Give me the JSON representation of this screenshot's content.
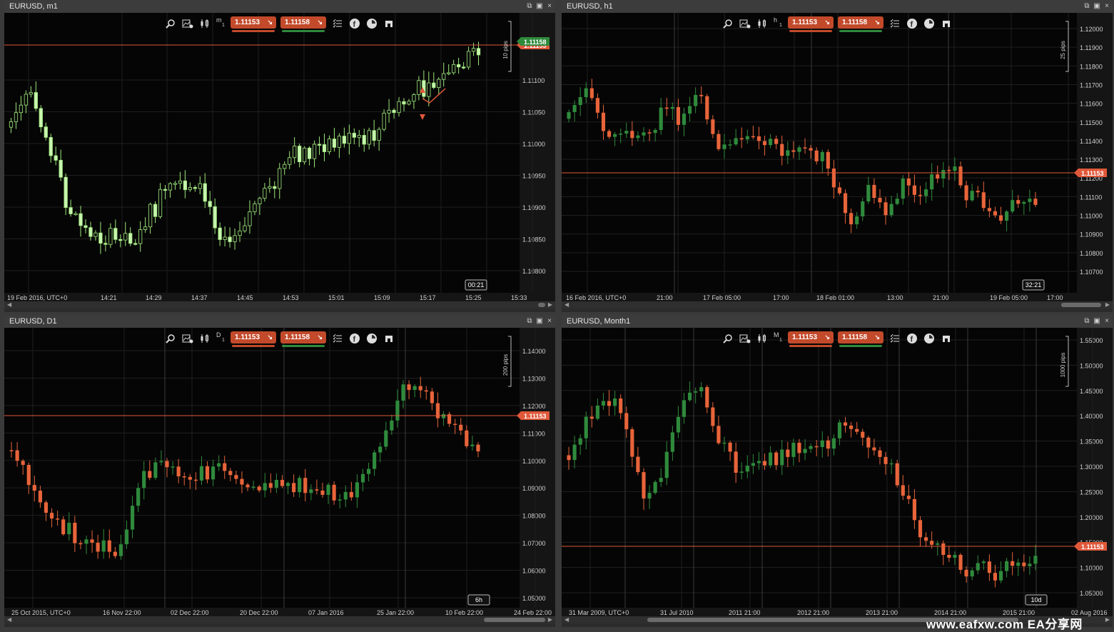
{
  "colors": {
    "bull": "#2f8a3c",
    "bear": "#e8643a",
    "m1_bull": "#0b0b0b",
    "m1_bear": "#c8f5b0",
    "m1_wick": "#9ee87a",
    "price_line": "#e0583a",
    "price_label_bg": "#e0583a",
    "sell_bar": "#c24a2b",
    "buy_bar": "#2f8a3c",
    "chart_bg": "#050505",
    "grid": "#1f1f1f",
    "axis_text": "#d0d0d0"
  },
  "window_controls": {
    "detach": "⧉",
    "maximize": "▣",
    "close": "×"
  },
  "toolbar": {
    "sell_price": "1.11153",
    "buy_price": "1.11158",
    "sell_arrow": "↘",
    "buy_arrow": "↘",
    "icons": [
      "zoom-icon",
      "chart-settings-icon",
      "chart-type-icon",
      "timeframe-selector",
      "sell-button",
      "buy-button",
      "order-list-icon",
      "facebook-icon",
      "sentiment-icon",
      "signal-icon"
    ]
  },
  "panels": [
    {
      "id": "m1",
      "title": "EURUSD, m1",
      "timeframe": "m",
      "timeframe_num": "1",
      "current_price": "1.11153",
      "countdown": "00:21",
      "range_label": "10 pips",
      "date_labels": [
        "19 Feb 2016, UTC+0",
        "14:21",
        "14:29",
        "14:37",
        "14:45",
        "14:53",
        "15:01",
        "15:09",
        "15:17",
        "15:25",
        "15:33"
      ],
      "price_ticks": [
        "1.11100",
        "1.11050",
        "1.11000",
        "1.10950",
        "1.10900",
        "1.10850",
        "1.10800"
      ],
      "extra_price_label": "1.11158"
    },
    {
      "id": "h1",
      "title": "EURUSD, h1",
      "timeframe": "h",
      "timeframe_num": "1",
      "current_price": "1.11153",
      "countdown": "32:21",
      "range_label": "25 pips",
      "date_labels": [
        "16 Feb 2016, UTC+0",
        "21:00",
        "17 Feb 05:00",
        "17:00",
        "18 Feb 01:00",
        "13:00",
        "21:00",
        "19 Feb 05:00",
        "17:00"
      ],
      "price_ticks": [
        "1.12000",
        "1.11900",
        "1.11800",
        "1.11700",
        "1.11600",
        "1.11500",
        "1.11400",
        "1.11300",
        "1.11200",
        "1.11100",
        "1.11000",
        "1.10900",
        "1.10800",
        "1.10700"
      ]
    },
    {
      "id": "d1",
      "title": "EURUSD, D1",
      "timeframe": "D",
      "timeframe_num": "1",
      "current_price": "1.11153",
      "countdown": "6h",
      "range_label": "200 pips",
      "date_labels": [
        "25 Oct 2015, UTC+0",
        "16 Nov 22:00",
        "02 Dec 22:00",
        "20 Dec 22:00",
        "07 Jan 2016",
        "25 Jan 22:00",
        "10 Feb 22:00",
        "24 Feb 22:00"
      ],
      "price_ticks": [
        "1.14000",
        "1.13000",
        "1.12000",
        "1.11000",
        "1.10000",
        "1.09000",
        "1.08000",
        "1.07000",
        "1.06000",
        "1.05000"
      ]
    },
    {
      "id": "mn1",
      "title": "EURUSD, Month1",
      "timeframe": "M",
      "timeframe_num": "1",
      "current_price": "1.11153",
      "countdown": "10d",
      "range_label": "1000 pips",
      "date_labels": [
        "31 Mar 2009, UTC+0",
        "31 Jul 2010",
        "2011 21:00",
        "2012 21:00",
        "2013 21:00",
        "2014 21:00",
        "2015 21:00",
        "02 Aug 2016"
      ],
      "price_ticks": [
        "1.55000",
        "1.50000",
        "1.45000",
        "1.40000",
        "1.35000",
        "1.30000",
        "1.25000",
        "1.20000",
        "1.15000",
        "1.10000",
        "1.05000"
      ]
    }
  ],
  "watermark": "www.eafxw.com  EA分享网"
}
